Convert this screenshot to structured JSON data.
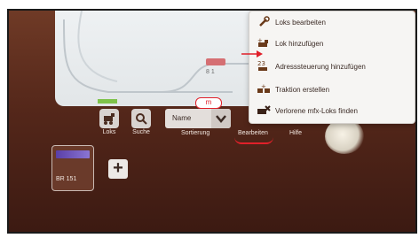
{
  "track": {
    "label": "8 1",
    "tab": "m"
  },
  "toolbar": {
    "locos_label": "Loks",
    "search_label": "Suche",
    "sort_label": "Sortierung",
    "sort_value": "Name",
    "edit_label": "Bearbeiten",
    "help_label": "Hilfe"
  },
  "locos": [
    {
      "name": "BR 151"
    }
  ],
  "menu": {
    "items": [
      {
        "label": "Loks bearbeiten",
        "icon": "wrench-icon"
      },
      {
        "label": "Lok hinzufügen",
        "icon": "add-loco-icon"
      },
      {
        "label": "Adresssteuerung hinzufügen",
        "icon": "address-control-icon"
      },
      {
        "label": "Traktion erstellen",
        "icon": "traction-icon"
      },
      {
        "label": "Verlorene mfx-Loks finden",
        "icon": "find-lost-loco-icon"
      }
    ]
  },
  "colors": {
    "annotation_red": "#e0202a",
    "panel_brown": "#54271a"
  }
}
